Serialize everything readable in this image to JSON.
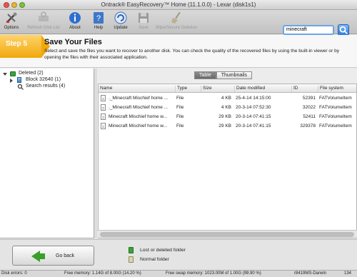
{
  "window": {
    "title": "Ontrack® EasyRecovery™ Home (11.1.0.0) - Lexar (disk1s1)"
  },
  "toolbar": {
    "buttons": [
      {
        "label": "Options",
        "icon": "tools-icon"
      },
      {
        "label": "Refresh Disk List",
        "icon": "refresh-disk-icon"
      },
      {
        "label": "About",
        "icon": "info-icon"
      },
      {
        "label": "Help",
        "icon": "help-icon"
      },
      {
        "label": "Update",
        "icon": "update-icon"
      },
      {
        "label": "Save",
        "icon": "save-icon"
      },
      {
        "label": "Wipe/Secure Deletion",
        "icon": "broom-icon"
      }
    ],
    "search_value": "minecraft"
  },
  "step": {
    "badge": "Step 5",
    "title": "Save Your Files",
    "description": "Select and save the files you want to recover to another disk. You can check the quality of the recovered files by using the built-in viewer or by opening the files with their associated application."
  },
  "tree": {
    "root": "Deleted (2)",
    "block": "Block 32640 (1)",
    "search": "Search results (4)"
  },
  "tabs": [
    "Table",
    "Thumbnails"
  ],
  "table": {
    "columns": [
      "Name",
      "Type",
      "Size",
      "Date modified",
      "ID",
      "File system"
    ],
    "rows": [
      {
        "name": "._Minecraft Mischief home ...",
        "type": "File",
        "size": "4 KB",
        "date": "25-4-14 14:15:00",
        "id": "52391",
        "fs": "FATVolumeItem"
      },
      {
        "name": "._Minecraft Mischief home ...",
        "type": "File",
        "size": "4 KB",
        "date": "20-3-14 07:52:30",
        "id": "32022",
        "fs": "FATVolumeItem"
      },
      {
        "name": "Minecraft Mischief home w...",
        "type": "File",
        "size": "29 KB",
        "date": "20-3-14 07:41:15",
        "id": "52411",
        "fs": "FATVolumeItem"
      },
      {
        "name": "Minecraft Mischief home w...",
        "type": "File",
        "size": "29 KB",
        "date": "20-3-14 07:41:15",
        "id": "329378",
        "fs": "FATVolumeItem"
      }
    ]
  },
  "bottom": {
    "back_label": "Go back",
    "legend": [
      "Lost or deleted folder",
      "Normal folder"
    ],
    "colors": {
      "lost_folder": "#3aa33a",
      "normal_folder": "#d8d8a8"
    }
  },
  "status": {
    "disk_errors": "Disk errors: 0",
    "free_memory": "Free memory: 1.14G of 8.00G (14.20 %)",
    "free_swap": "Free swap memory: 1023.00M of 1.00G (99.90 %)",
    "build": "r8419MS-Darwin",
    "count": "134"
  }
}
